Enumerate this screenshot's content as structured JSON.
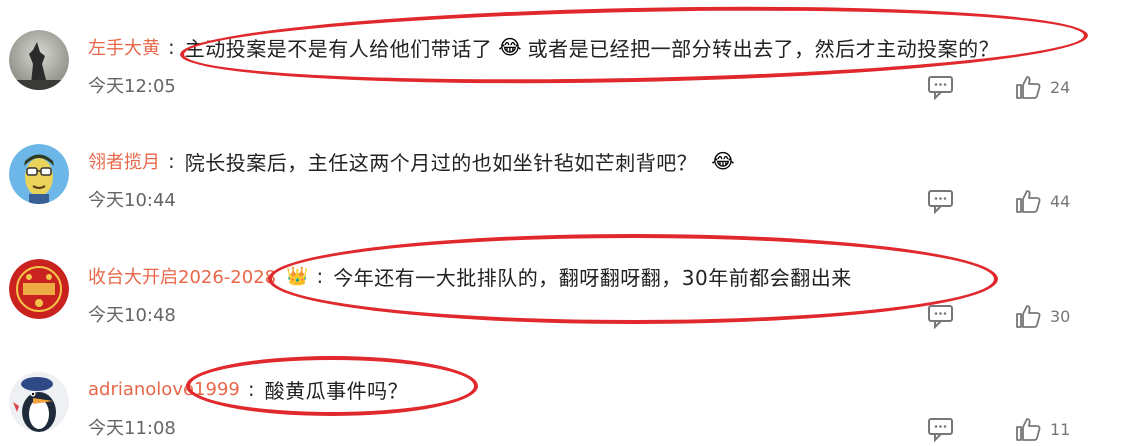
{
  "comments": [
    {
      "username": "左手大黄",
      "text_a": "主动投案是不是有人给他们带话了",
      "emoji_a": "😂",
      "text_b": "或者是已经把一部分转出去了，然后才主动投案的？",
      "time": "今天12:05",
      "likes": "24",
      "avatar_icon": "wolf-avatar"
    },
    {
      "username": "翎者揽月",
      "text_a": "院长投案后，主任这两个月过的也如坐针毡如芒刺背吧？",
      "emoji_a": "😂",
      "time": "今天10:44",
      "likes": "44",
      "avatar_icon": "cartoon-face-avatar"
    },
    {
      "username": "收台大开启2026-2028",
      "badge": "👑",
      "text_a": "今年还有一大批排队的，翻呀翻呀翻，30年前都会翻出来",
      "time": "今天10:48",
      "likes": "30",
      "avatar_icon": "red-stamp-avatar"
    },
    {
      "username": "adrianolove1999",
      "text_a": "酸黄瓜事件吗？",
      "time": "今天11:08",
      "likes": "11",
      "avatar_icon": "penguin-avatar"
    }
  ],
  "icons": {
    "reply": "comment-reply-icon",
    "like": "thumbs-up-icon"
  },
  "colors": {
    "username": "#e8674a",
    "highlight_ellipse": "#e0282d",
    "text": "#222222",
    "time": "#666666"
  }
}
